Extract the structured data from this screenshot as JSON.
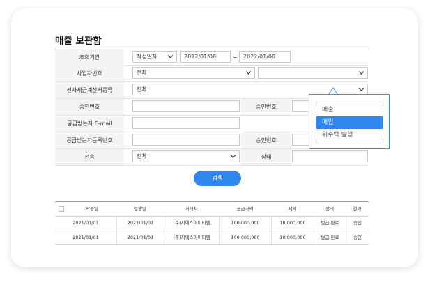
{
  "title": "매출 보관함",
  "form": {
    "period": {
      "label": "조회기간",
      "type_value": "작성일자",
      "date_from": "2022/01/08",
      "tilde": "~",
      "date_to": "2022/01/08"
    },
    "biz_no": {
      "label": "사업자번호",
      "select_value": "전체",
      "select2_value": ""
    },
    "doc_type": {
      "label": "전자세금계산서종류",
      "select_value": "전체"
    },
    "approval_no": {
      "label": "승인번호",
      "value": "",
      "label2": "승인번호",
      "value2": ""
    },
    "email": {
      "label": "공급받는자 E-mail",
      "value": ""
    },
    "reg_no": {
      "label": "공급받는자등록번호",
      "value": "",
      "label2": "승인번호",
      "value2": ""
    },
    "transmit": {
      "label": "전송",
      "select_value": "전체",
      "label2": "상태",
      "value2": ""
    }
  },
  "search_button": "검색",
  "dropdown": {
    "options": [
      "매출",
      "매입",
      "위수탁 발행"
    ],
    "selected_index": 1
  },
  "table": {
    "headers": [
      "작성일",
      "발행일",
      "거래처",
      "공급가액",
      "세액",
      "상태",
      "결과"
    ],
    "rows": [
      [
        "2021/01/01",
        "2021/01/01",
        "(주)지에스아이티엠",
        "100,000,000",
        "10,000,000",
        "발급 완료",
        "승인"
      ],
      [
        "2021/01/01",
        "2021/01/01",
        "(주)지에스아이티엠",
        "100,000,000",
        "10,000,000",
        "발급 완료",
        "승인"
      ]
    ]
  },
  "colors": {
    "accent": "#2f86ee",
    "label_bg": "#f4f4f4",
    "dropdown_border": "#3b8fe8"
  },
  "icons": {
    "chevron": "chevron-down-icon",
    "caret": "caret-up-icon"
  }
}
